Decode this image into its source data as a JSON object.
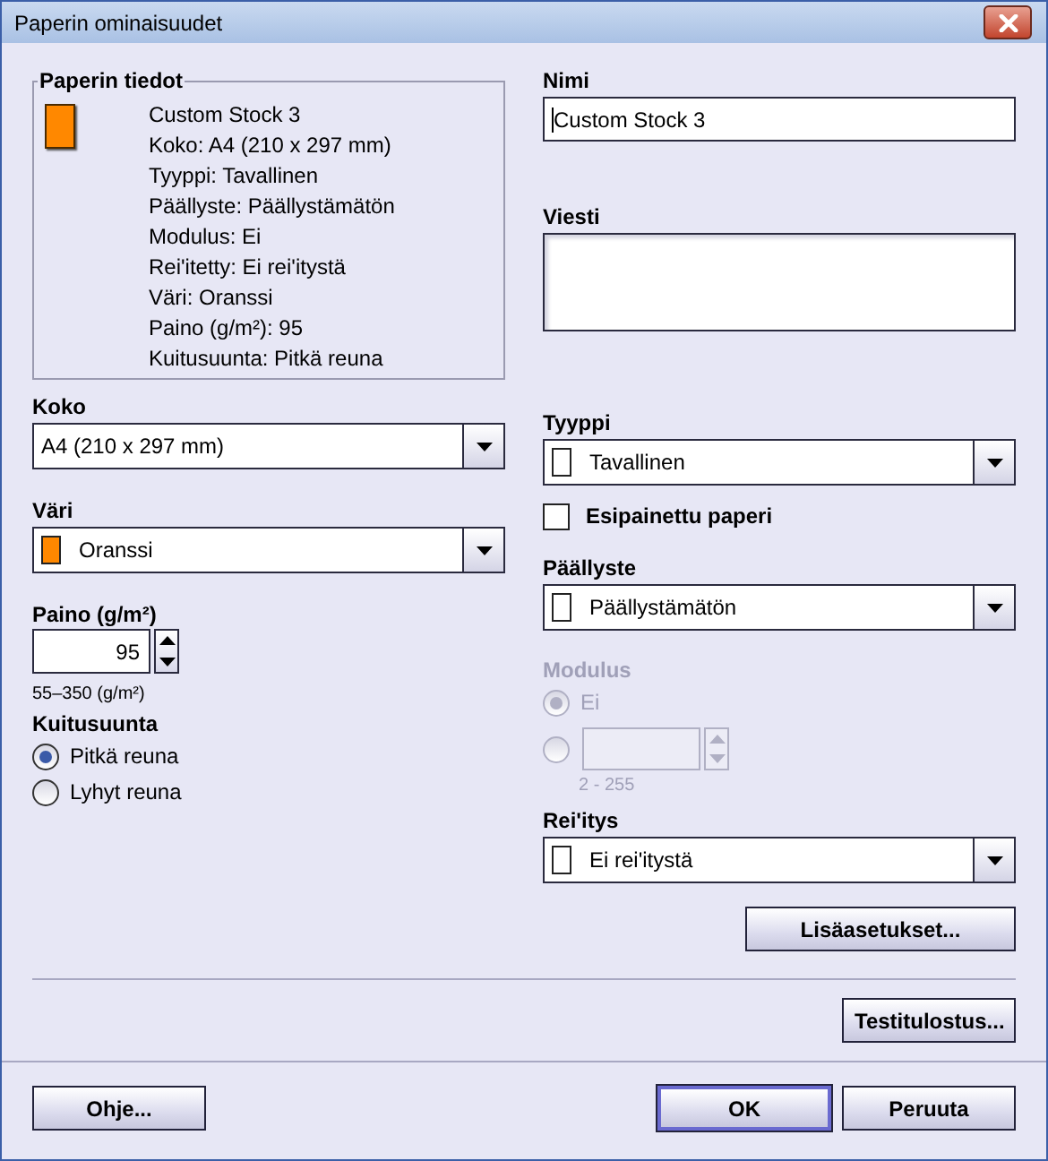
{
  "window": {
    "title": "Paperin ominaisuudet"
  },
  "paper_info": {
    "title": "Paperin tiedot",
    "color": "#ff8800",
    "lines": [
      "Custom Stock 3",
      "Koko: A4 (210 x 297 mm)",
      "Tyyppi: Tavallinen",
      "Päällyste: Päällystämätön",
      "Modulus: Ei",
      "Rei'itetty: Ei rei'itystä",
      "Väri: Oranssi",
      "Paino (g/m²): 95",
      "Kuitusuunta: Pitkä reuna"
    ]
  },
  "size": {
    "label": "Koko",
    "value": "A4 (210 x 297 mm)"
  },
  "color": {
    "label": "Väri",
    "value": "Oranssi",
    "color": "#ff8800"
  },
  "weight": {
    "label": "Paino (g/m²)",
    "value": "95",
    "range": "55–350 (g/m²)"
  },
  "grain": {
    "label": "Kuitusuunta",
    "options": [
      {
        "label": "Pitkä reuna",
        "selected": true
      },
      {
        "label": "Lyhyt reuna",
        "selected": false
      }
    ]
  },
  "name": {
    "label": "Nimi",
    "value": "Custom Stock 3"
  },
  "message": {
    "label": "Viesti"
  },
  "type": {
    "label": "Tyyppi",
    "value": "Tavallinen",
    "color": "#ffffff"
  },
  "preprinted": {
    "label": "Esipainettu paperi",
    "checked": false
  },
  "coating": {
    "label": "Päällyste",
    "value": "Päällystämätön",
    "color": "#ffffff"
  },
  "modulus": {
    "label": "Modulus",
    "disabled": true,
    "options": [
      {
        "kind": "label",
        "label": "Ei",
        "selected": true
      },
      {
        "kind": "spinner",
        "selected": false
      }
    ],
    "range": "2 - 255"
  },
  "punching": {
    "label": "Rei'itys",
    "value": "Ei rei'itystä",
    "color": "#ffffff"
  },
  "advanced_button": "Lisäasetukset...",
  "test_print_button": "Testitulostus...",
  "footer": {
    "left_buttons": [
      {
        "label": "Ohje...",
        "default": false
      }
    ],
    "right_buttons": [
      {
        "label": "OK",
        "default": true
      },
      {
        "label": "Peruuta",
        "default": false
      }
    ]
  }
}
